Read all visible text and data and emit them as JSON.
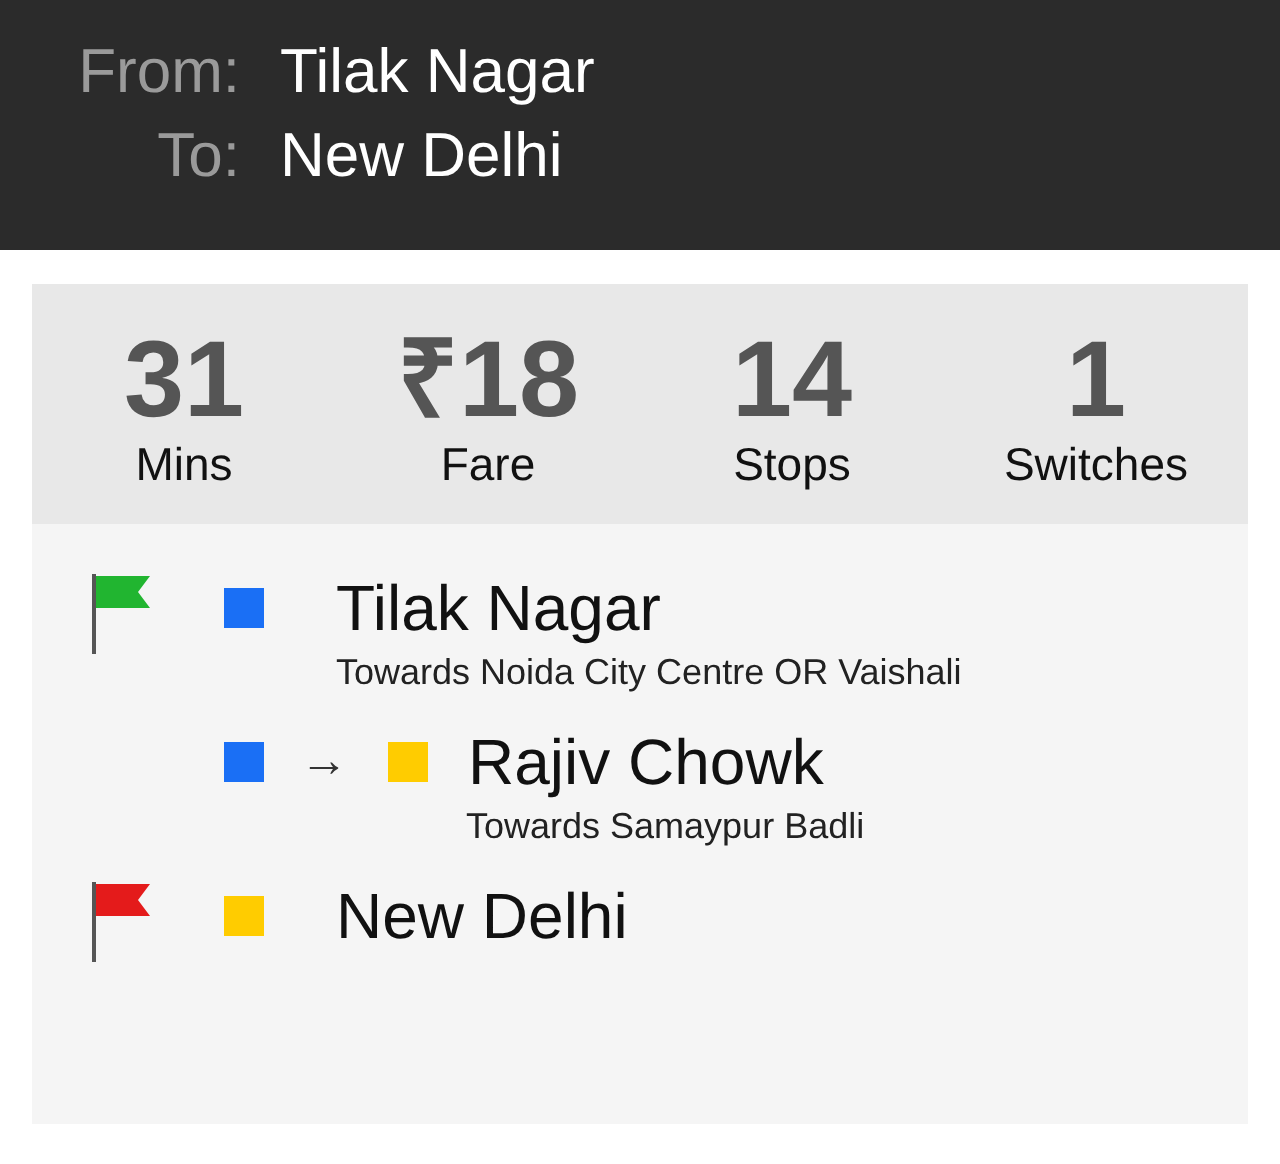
{
  "header": {
    "from_label": "From:",
    "from": "Tilak Nagar",
    "to_label": "To:",
    "to": "New Delhi"
  },
  "stats": [
    {
      "value": "31",
      "label": "Mins"
    },
    {
      "value": "₹18",
      "label": "Fare"
    },
    {
      "value": "14",
      "label": "Stops"
    },
    {
      "value": "1",
      "label": "Switches"
    }
  ],
  "route": [
    {
      "kind": "start",
      "flag": {
        "color": "#21b530"
      },
      "lines": [
        {
          "color": "#1a6ff5"
        }
      ],
      "station": "Tilak Nagar",
      "direction": "Towards Noida City Centre OR Vaishali"
    },
    {
      "kind": "switch",
      "lines": [
        {
          "color": "#1a6ff5"
        },
        {
          "color": "#ffcc00"
        }
      ],
      "arrow": "→",
      "station": "Rajiv Chowk",
      "direction": "Towards Samaypur Badli"
    },
    {
      "kind": "end",
      "flag": {
        "color": "#e41b1b"
      },
      "lines": [
        {
          "color": "#ffcc00"
        }
      ],
      "station": "New Delhi"
    }
  ]
}
